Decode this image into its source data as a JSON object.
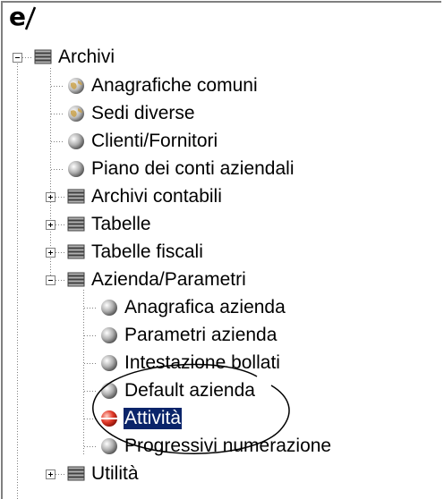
{
  "logo_text": "e",
  "tree": {
    "nodes": [
      {
        "label": "Archivi",
        "icon": "stack-icon",
        "state": "expanded"
      },
      {
        "label": "Anagrafiche comuni",
        "icon": "globe-icon"
      },
      {
        "label": "Sedi diverse",
        "icon": "globe-icon"
      },
      {
        "label": "Clienti/Fornitori",
        "icon": "gray-ball-icon"
      },
      {
        "label": "Piano dei conti aziendali",
        "icon": "gray-ball-icon"
      },
      {
        "label": "Archivi contabili",
        "icon": "stack-icon",
        "state": "collapsed"
      },
      {
        "label": "Tabelle",
        "icon": "stack-icon",
        "state": "collapsed"
      },
      {
        "label": "Tabelle fiscali",
        "icon": "stack-icon",
        "state": "collapsed"
      },
      {
        "label": "Azienda/Parametri",
        "icon": "stack-icon",
        "state": "expanded"
      },
      {
        "label": "Anagrafica azienda",
        "icon": "gray-ball-icon"
      },
      {
        "label": "Parametri azienda",
        "icon": "gray-ball-icon"
      },
      {
        "label": "Intestazione bollati",
        "icon": "gray-ball-icon"
      },
      {
        "label": "Default azienda",
        "icon": "gray-ball-icon"
      },
      {
        "label": "Attività",
        "icon": "red-ball-icon",
        "selected": true
      },
      {
        "label": "Progressivi numerazione",
        "icon": "gray-ball-icon"
      },
      {
        "label": "Utilità",
        "icon": "stack-icon",
        "state": "collapsed"
      }
    ]
  },
  "colors": {
    "selection_bg": "#0a246a",
    "selection_text": "#ffffff",
    "tree_lines": "#808080",
    "active_icon": "#e23a2a"
  }
}
